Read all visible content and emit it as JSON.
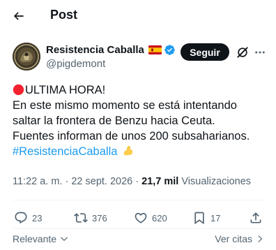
{
  "header": {
    "title": "Post",
    "back_icon": "arrow-left-icon"
  },
  "author": {
    "display_name": "Resistencia Caballa",
    "flag_icon": "spain-flag-icon",
    "verified_icon": "verified-badge-icon",
    "handle": "@pigdemont",
    "follow_label": "Seguir",
    "grok_icon": "grok-icon",
    "more_icon": "more-horizontal-icon"
  },
  "tweet": {
    "alert_icon": "red-circle-icon",
    "line1": "ULTIMA HORA!",
    "line2": "En este mismo momento se está intentando",
    "line3": "saltar la frontera de Benzu hacia Ceuta.",
    "line4": "Fuentes informan de unos 200 subsaharianos.",
    "hashtag": "#ResistenciaCaballa",
    "emoji_icon": "flexed-biceps-icon"
  },
  "meta": {
    "time": "11:22 a. m.",
    "separator": " · ",
    "date": "22 sept. 2026",
    "views_count": "21,7 mil",
    "views_label": " Visualizaciones"
  },
  "actions": {
    "replies": "23",
    "reposts": "376",
    "likes": "620",
    "bookmarks": "17"
  },
  "bottom": {
    "sort_label": "Relevante",
    "quotes_label": "Ver citas"
  },
  "colors": {
    "accent": "#1d9bf0",
    "text_primary": "#0f1419",
    "text_secondary": "#536471",
    "alert_red": "#f4212e"
  }
}
